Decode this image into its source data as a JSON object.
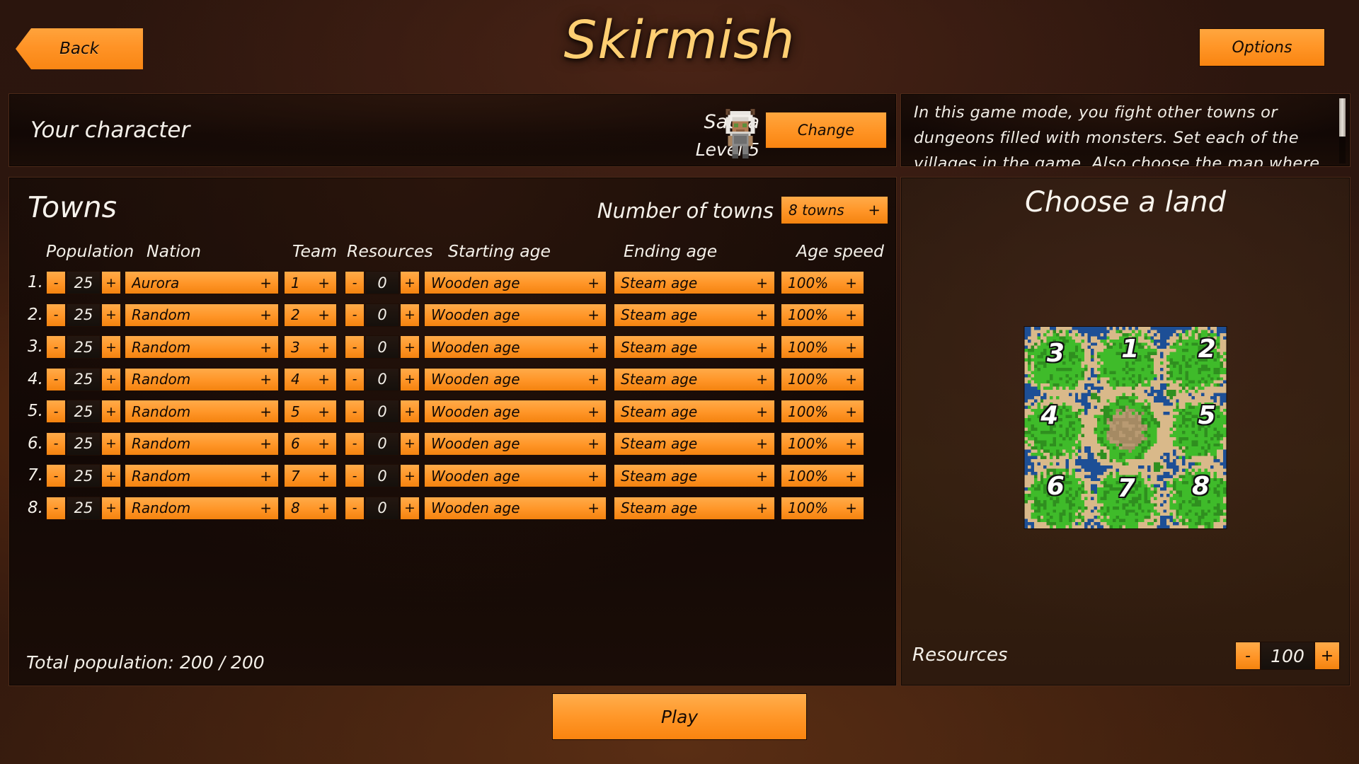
{
  "header": {
    "title": "Skirmish",
    "back_label": "Back",
    "options_label": "Options"
  },
  "character": {
    "section_label": "Your character",
    "name": "Saura",
    "level": "Level 5",
    "change_label": "Change",
    "avatar_icon": "character-sprite-icon"
  },
  "description": {
    "text": "In this game mode, you fight other towns or dungeons filled with monsters. Set each of the villages in the game. Also choose the map where"
  },
  "towns": {
    "title": "Towns",
    "number_of_towns_label": "Number of towns",
    "number_of_towns_value": "8 towns",
    "plus_glyph": "+",
    "minus_glyph": "-",
    "columns": [
      "Population",
      "Nation",
      "Team",
      "Resources",
      "Starting age",
      "Ending age",
      "Age speed"
    ],
    "rows": [
      {
        "index": "1.",
        "population": "25",
        "nation": "Aurora",
        "team": "1",
        "resources": "0",
        "starting_age": "Wooden age",
        "ending_age": "Steam age",
        "age_speed": "100%"
      },
      {
        "index": "2.",
        "population": "25",
        "nation": "Random",
        "team": "2",
        "resources": "0",
        "starting_age": "Wooden age",
        "ending_age": "Steam age",
        "age_speed": "100%"
      },
      {
        "index": "3.",
        "population": "25",
        "nation": "Random",
        "team": "3",
        "resources": "0",
        "starting_age": "Wooden age",
        "ending_age": "Steam age",
        "age_speed": "100%"
      },
      {
        "index": "4.",
        "population": "25",
        "nation": "Random",
        "team": "4",
        "resources": "0",
        "starting_age": "Wooden age",
        "ending_age": "Steam age",
        "age_speed": "100%"
      },
      {
        "index": "5.",
        "population": "25",
        "nation": "Random",
        "team": "5",
        "resources": "0",
        "starting_age": "Wooden age",
        "ending_age": "Steam age",
        "age_speed": "100%"
      },
      {
        "index": "6.",
        "population": "25",
        "nation": "Random",
        "team": "6",
        "resources": "0",
        "starting_age": "Wooden age",
        "ending_age": "Steam age",
        "age_speed": "100%"
      },
      {
        "index": "7.",
        "population": "25",
        "nation": "Random",
        "team": "7",
        "resources": "0",
        "starting_age": "Wooden age",
        "ending_age": "Steam age",
        "age_speed": "100%"
      },
      {
        "index": "8.",
        "population": "25",
        "nation": "Random",
        "team": "8",
        "resources": "0",
        "starting_age": "Wooden age",
        "ending_age": "Steam age",
        "age_speed": "100%"
      }
    ],
    "total_population": "Total population: 200 / 200"
  },
  "land": {
    "title": "Choose a land",
    "map_numbers": [
      "1",
      "2",
      "3",
      "4",
      "5",
      "6",
      "7",
      "8"
    ],
    "resources_label": "Resources",
    "resources_value": "100",
    "minus_glyph": "-",
    "plus_glyph": "+"
  },
  "play": {
    "label": "Play"
  },
  "colors": {
    "accent_orange": "#ff9527",
    "accent_orange_light": "#ffab49",
    "title_gold": "#ffcf72",
    "panel_dark": "#150b06",
    "panel_brown": "#311d11",
    "text_light": "#f4f0e9",
    "map_water": "#1d4f96",
    "map_grass": "#3fbb2a",
    "map_sand": "#d9b98a"
  }
}
